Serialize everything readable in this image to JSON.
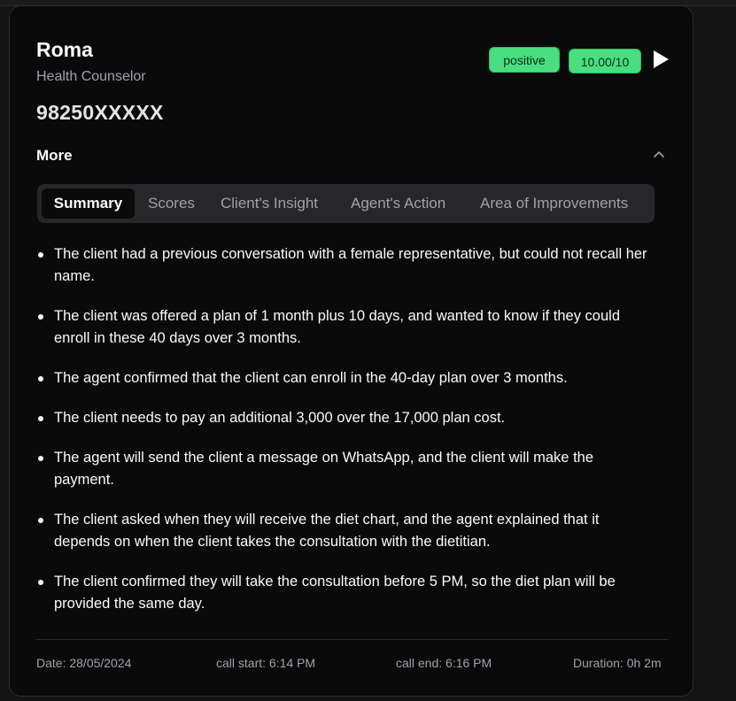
{
  "agent": {
    "name": "Roma",
    "role": "Health Counselor",
    "phone": "98250XXXXX"
  },
  "badges": {
    "sentiment": "positive",
    "score": "10.00/10"
  },
  "section": {
    "more_label": "More"
  },
  "tabs": [
    {
      "label": "Summary",
      "active": true
    },
    {
      "label": "Scores",
      "active": false
    },
    {
      "label": "Client's Insight",
      "active": false
    },
    {
      "label": "Agent's Action",
      "active": false
    },
    {
      "label": "Area of Improvements",
      "active": false
    }
  ],
  "summary": [
    "The client had a previous conversation with a female representative, but could not recall her name.",
    "The client was offered a plan of 1 month plus 10 days, and wanted to know if they could enroll in these 40 days over 3 months.",
    "The agent confirmed that the client can enroll in the 40-day plan over 3 months.",
    "The client needs to pay an additional 3,000 over the 17,000 plan cost.",
    "The agent will send the client a message on WhatsApp, and the client will make the payment.",
    "The client asked when they will receive the diet chart, and the agent explained that it depends on when the client takes the consultation with the dietitian.",
    "The client confirmed they will take the consultation before 5 PM, so the diet plan will be provided the same day."
  ],
  "footer": {
    "date": "Date: 28/05/2024",
    "call_start": "call start: 6:14 PM",
    "call_end": "call end: 6:16 PM",
    "duration": "Duration: 0h 2m"
  },
  "colors": {
    "accent_green": "#4ade80",
    "card_bg": "#0a0a0b",
    "tabs_bg": "#27272a"
  }
}
